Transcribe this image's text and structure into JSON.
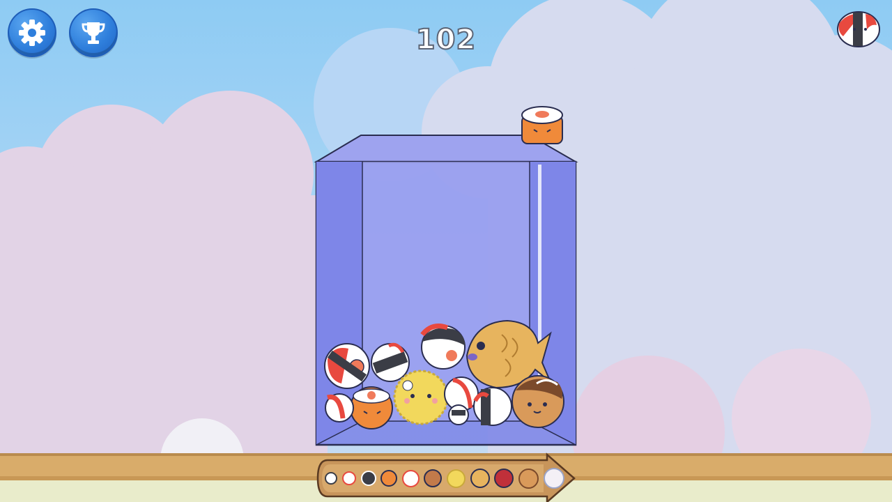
{
  "game": {
    "score": "102"
  },
  "buttons": {
    "settings": {
      "icon": "gear-icon"
    },
    "trophy": {
      "icon": "trophy-icon"
    }
  },
  "next_piece": {
    "icon": "salmon-nigiri-icon"
  },
  "held_piece": {
    "icon": "salmon-roll-icon"
  },
  "container": {
    "pieces": [
      "salmon-roll-maki",
      "onigiri",
      "salmon-nigiri",
      "pufferfish",
      "taiyaki",
      "takoyaki"
    ]
  },
  "evolution_bar": {
    "items": [
      "onigiri",
      "nigiri",
      "maki",
      "salmon-roll",
      "tuna-nigiri",
      "dango",
      "chick",
      "taiyaki",
      "red-bean",
      "takoyaki",
      "daifuku"
    ]
  },
  "colors": {
    "sky": "#8ecbf3",
    "cloud_pink": "#e2d3e6",
    "cloud_lavender": "#d6dbef",
    "container": "#7a82e6",
    "button_blue": "#2f7fdc",
    "ground": "#d9ac6a",
    "ground_light": "#e9eccb"
  }
}
